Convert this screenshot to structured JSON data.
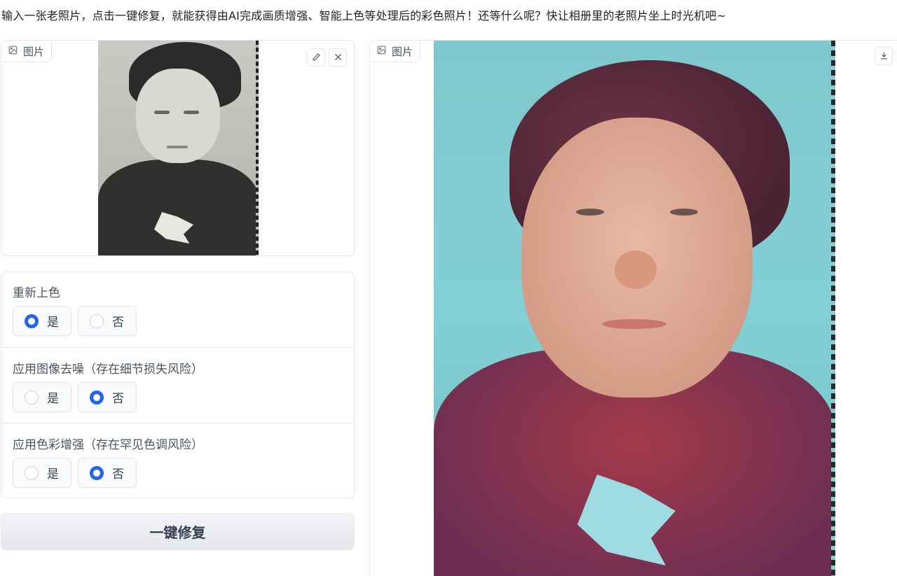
{
  "description": "输入一张老照片，点击一键修复，就能获得由AI完成画质增强、智能上色等处理后的彩色照片！还等什么呢？快让相册里的老照片坐上时光机吧~",
  "input_panel": {
    "label": "图片",
    "label_icon": "image-icon",
    "edit_icon": "pencil-icon",
    "clear_icon": "close-icon"
  },
  "output_panel": {
    "label": "图片",
    "label_icon": "image-icon",
    "download_icon": "download-icon"
  },
  "options": [
    {
      "title": "重新上色",
      "choices": [
        "是",
        "否"
      ],
      "selected": "是"
    },
    {
      "title": "应用图像去噪（存在细节损失风险）",
      "choices": [
        "是",
        "否"
      ],
      "selected": "否"
    },
    {
      "title": "应用色彩增强（存在罕见色调风险）",
      "choices": [
        "是",
        "否"
      ],
      "selected": "否"
    }
  ],
  "submit_label": "一键修复",
  "colors": {
    "accent": "#2563eb",
    "border": "#e5e7eb"
  }
}
